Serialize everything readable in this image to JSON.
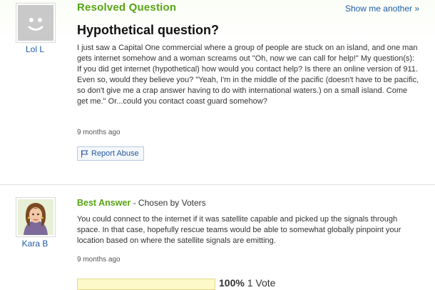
{
  "question": {
    "status": "Resolved Question",
    "show_another": "Show me another »",
    "title": "Hypothetical question?",
    "body": "I just saw a Capital One commercial where a group of people are stuck on an island, and one man gets internet somehow and a woman screams out \"Oh, now we can call for help!\" My question(s): If you did get internet (hypothetical) how would you contact help? Is there an online version of 911. Even so, would they believe you? \"Yeah, I'm in the middle of the pacific (doesn't have to be pacific, so don't give me a crap answer having to do with international waters.) on a small island. Come get me.\" Or...could you contact coast guard somehow?",
    "asker": "Lol L",
    "asked_ago": "9 months ago",
    "report_label": "Report Abuse"
  },
  "answer": {
    "label": "Best Answer",
    "chosen_by": " - Chosen by Voters",
    "body": "You could connect to the internet if it was satellite capable and picked up the signals through space. In that case, hopefully rescue teams would be able to somewhat globally pinpoint your location based on where the satellite signals are emitting.",
    "answerer": "Kara B",
    "answered_ago": "9 months ago",
    "vote_percent": "100%",
    "vote_count": "1 Vote",
    "vote_fraction": 1.0
  },
  "colors": {
    "resolved_green": "#56a414",
    "link_blue": "#1f5ca6",
    "vote_bar": "#fdf9c8"
  },
  "icons": {
    "asker_avatar": "default-smiley-avatar-icon",
    "answerer_avatar": "girl-avatar-icon",
    "report": "flag-icon"
  }
}
